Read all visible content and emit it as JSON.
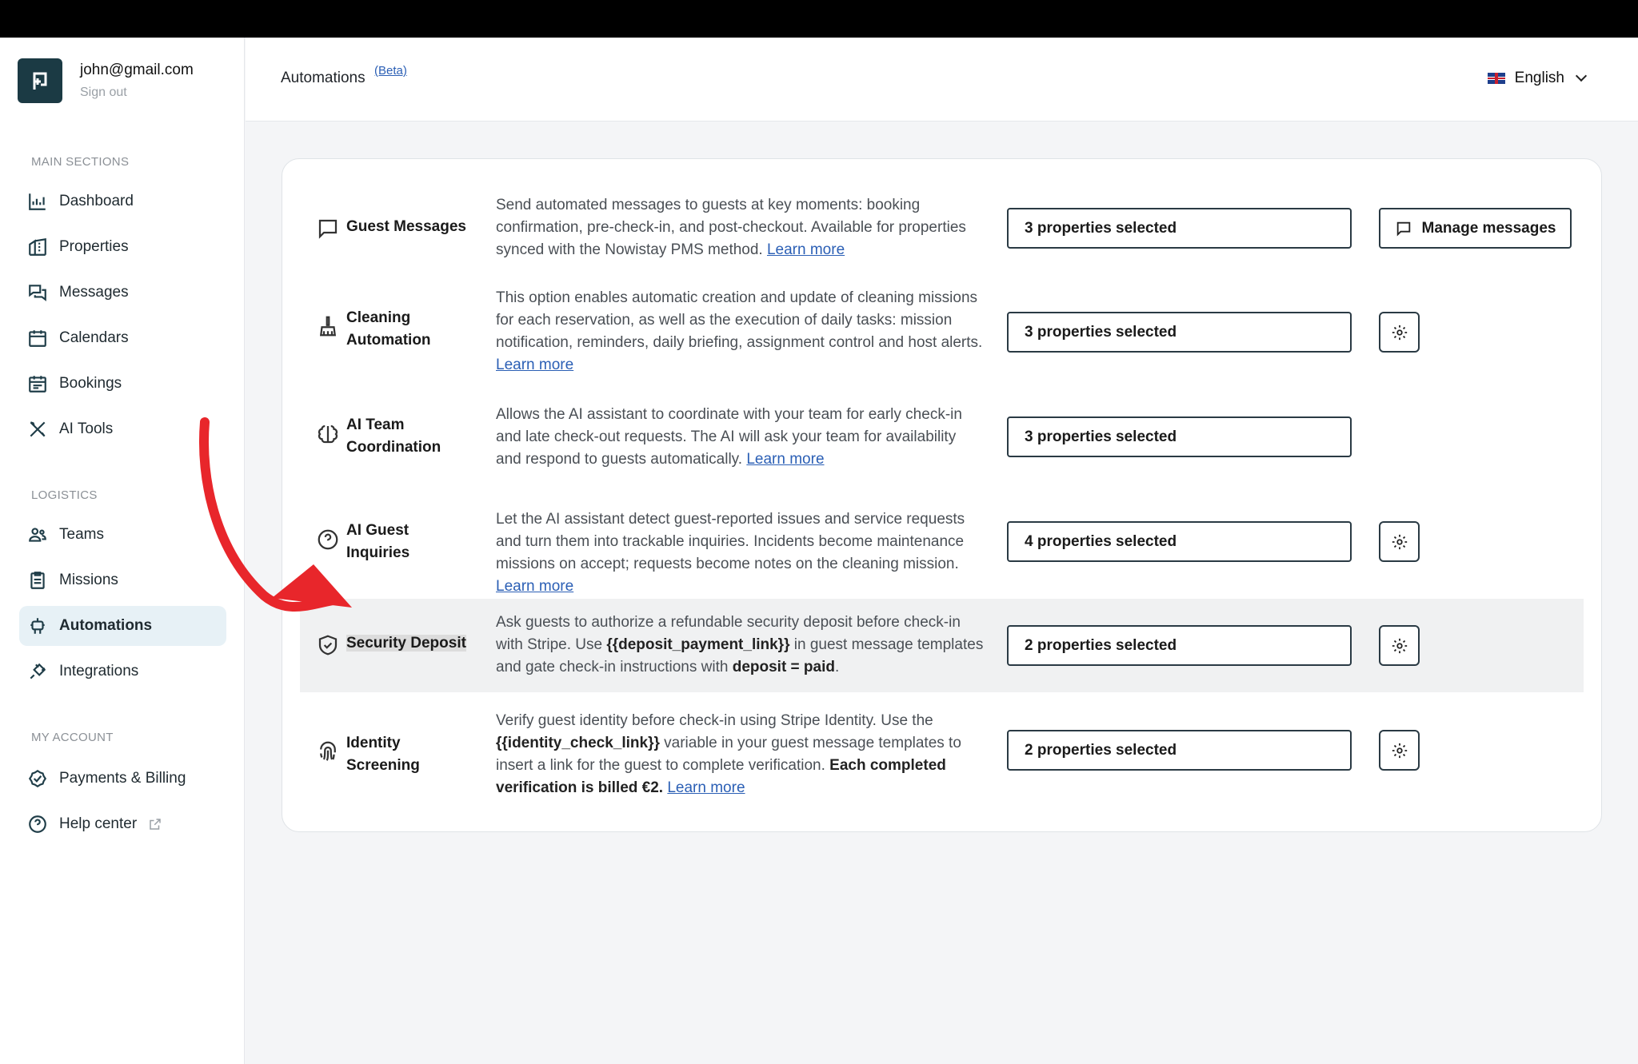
{
  "account": {
    "email": "john@gmail.com",
    "sign_out": "Sign out"
  },
  "sidebar": {
    "main_title": "MAIN SECTIONS",
    "main": [
      {
        "label": "Dashboard",
        "icon": "chart-icon"
      },
      {
        "label": "Properties",
        "icon": "building-icon"
      },
      {
        "label": "Messages",
        "icon": "chat-icon"
      },
      {
        "label": "Calendars",
        "icon": "calendar-icon"
      },
      {
        "label": "Bookings",
        "icon": "bookings-icon"
      },
      {
        "label": "AI Tools",
        "icon": "tools-icon"
      }
    ],
    "logistics_title": "LOGISTICS",
    "logistics": [
      {
        "label": "Teams",
        "icon": "team-icon"
      },
      {
        "label": "Missions",
        "icon": "clipboard-icon"
      },
      {
        "label": "Automations",
        "icon": "robot-icon",
        "active": true
      },
      {
        "label": "Integrations",
        "icon": "plug-icon"
      }
    ],
    "account_title": "MY ACCOUNT",
    "account_items": [
      {
        "label": "Payments & Billing",
        "icon": "badge-check-icon"
      },
      {
        "label": "Help center",
        "icon": "help-icon"
      }
    ]
  },
  "header": {
    "title": "Automations",
    "beta": "(Beta)",
    "language": "English"
  },
  "automations": [
    {
      "name": "Guest Messages",
      "desc_parts": [
        "Send automated messages to guests at key moments: booking confirmation, pre-check-in, and post-checkout. Available for properties synced with the Nowistay PMS method. "
      ],
      "link": "Learn more",
      "selection": "3 properties selected",
      "action": "Manage messages"
    },
    {
      "name": "Cleaning Automation",
      "desc_parts": [
        "This option enables automatic creation and update of cleaning missions for each reservation, as well as the execution of daily tasks: mission notification, reminders, daily briefing, assignment control and host alerts. "
      ],
      "link": "Learn more",
      "selection": "3 properties selected"
    },
    {
      "name": "AI Team Coordination",
      "desc_parts": [
        "Allows the AI assistant to coordinate with your team for early check-in and late check-out requests. The AI will ask your team for availability and respond to guests automatically. "
      ],
      "link": "Learn more",
      "selection": "3 properties selected"
    },
    {
      "name": "AI Guest Inquiries",
      "desc_parts": [
        "Let the AI assistant detect guest-reported issues and service requests and turn them into trackable inquiries. Incidents become maintenance missions on accept; requests become notes on the cleaning mission. "
      ],
      "link": "Learn more",
      "selection": "4 properties selected"
    },
    {
      "name": "Security Deposit",
      "desc_a": "Ask guests to authorize a refundable security deposit before check-in with Stripe. Use ",
      "desc_b": "{{deposit_payment_link}}",
      "desc_c": " in guest message templates and gate check-in instructions with ",
      "desc_d": "deposit = paid",
      "desc_e": ".",
      "selection": "2 properties selected"
    },
    {
      "name": "Identity Screening",
      "desc_a": "Verify guest identity before check-in using Stripe Identity. Use the ",
      "desc_b": "{{identity_check_link}}",
      "desc_c": " variable in your guest message templates to insert a link for the guest to complete verification. ",
      "desc_d": "Each completed verification is billed €2.",
      "link": "Learn more",
      "selection": "2 properties selected"
    }
  ],
  "colors": {
    "brand": "#1b3a44",
    "active_bg": "#e7f1f6",
    "link": "#2b5fb5",
    "arrow": "#e8262b"
  }
}
